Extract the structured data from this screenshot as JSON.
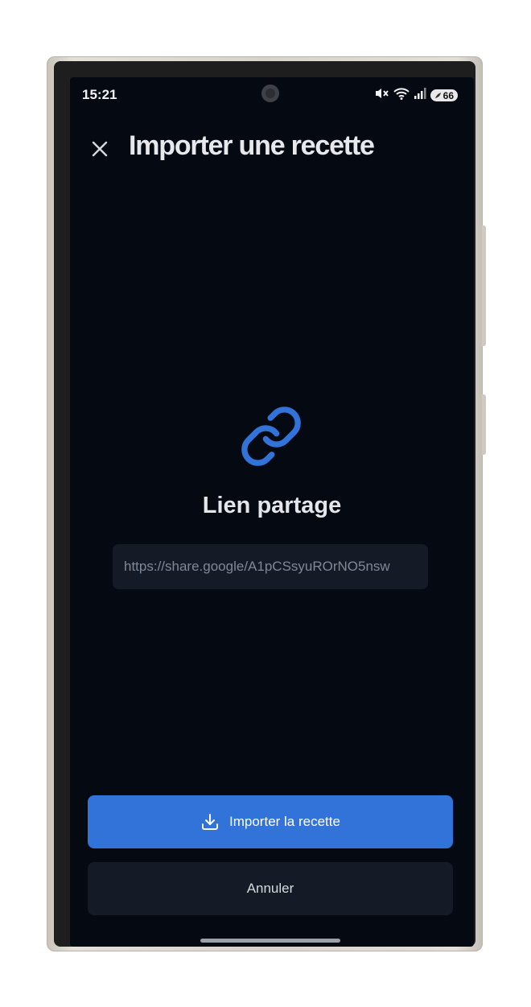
{
  "status_bar": {
    "time": "15:21",
    "battery": "66",
    "icons": [
      "mute-icon",
      "wifi-icon",
      "signal-icon",
      "battery-icon"
    ]
  },
  "header": {
    "title": "Importer une recette",
    "close_icon": "close-icon"
  },
  "main": {
    "icon": "link-icon",
    "label": "Lien partage",
    "url_value": "https://share.google/A1pCSsyuROrNO5nsw"
  },
  "actions": {
    "import_label": "Importer la recette",
    "import_icon": "download-icon",
    "cancel_label": "Annuler"
  },
  "colors": {
    "accent": "#3273d9",
    "background": "#040912",
    "field": "#151b26"
  }
}
